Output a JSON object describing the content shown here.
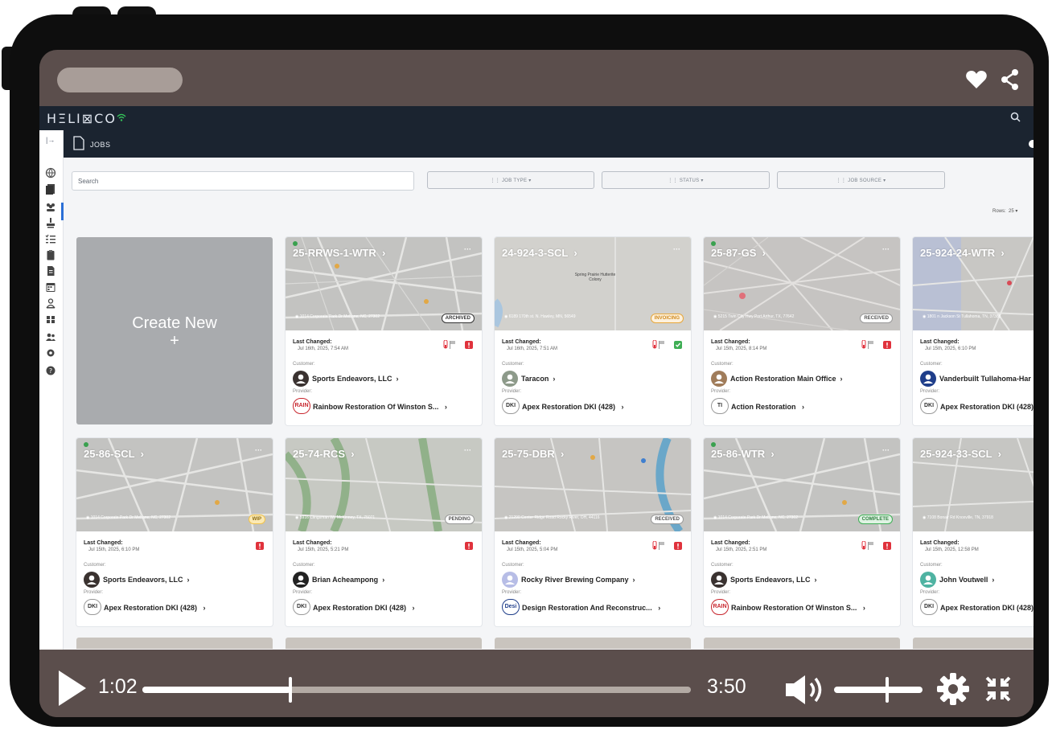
{
  "app": {
    "logo": "HΞLI⊠CO",
    "page_title": "JOBS",
    "search_placeholder": "Search",
    "filters": [
      "JOB TYPE",
      "STATUS",
      "JOB SOURCE"
    ],
    "rows_label": "Rows:",
    "rows_value": "25",
    "create_label": "Create New",
    "create_plus": "+"
  },
  "labels": {
    "last_changed": "Last Changed:",
    "customer": "Customer:",
    "provider": "Provider:",
    "more": "···"
  },
  "jobs": [
    {
      "id": "25-RRWS-1-WTR",
      "address": "1014 Corporate Park Dr Mebane, NC, 27302",
      "status": "ARCHIVED",
      "last_changed": "Jul 16th, 2025, 7:54 AM",
      "customer": "Sports Endeavors, LLC",
      "provider": "Rainbow Restoration Of Winston S...",
      "provider_badge": "RAIN"
    },
    {
      "id": "24-924-3-SCL",
      "address": "6189 170th st. N. Hawley, MN, 56549",
      "status": "INVOICING",
      "last_changed": "Jul 16th, 2025, 7:51 AM",
      "customer": "Taracon",
      "provider": "Apex Restoration DKI (428)",
      "provider_badge": "DKI",
      "map_text": "Spring Prairie Hutterite Colony"
    },
    {
      "id": "25-87-GS",
      "address": "5215 Twin City Hwy Port Arthur, TX, 77642",
      "status": "RECEIVED",
      "last_changed": "Jul 15th, 2025, 8:14 PM",
      "customer": "Action Restoration Main Office",
      "provider": "Action Restoration",
      "provider_badge": "TI"
    },
    {
      "id": "25-924-24-WTR",
      "address": "1801 n Jackson St Tullahoma, TN, 37388",
      "status": "",
      "last_changed": "Jul 15th, 2025, 6:10 PM",
      "customer": "Vanderbuilt Tullahoma-Har",
      "provider": "Apex Restoration DKI (428)",
      "provider_badge": "DKI"
    },
    {
      "id": "25-86-SCL",
      "address": "1014 Corporate Park Dr Mebane, NC, 27302",
      "status": "WIP",
      "last_changed": "Jul 15th, 2025, 6:10 PM",
      "customer": "Sports Endeavors, LLC",
      "provider": "Apex Restoration DKI (428)",
      "provider_badge": "DKI"
    },
    {
      "id": "25-74-RCS",
      "address": "5916 Clingsman Wy McKinney, TX, 75071",
      "status": "PENDING",
      "last_changed": "Jul 15th, 2025, 5:21 PM",
      "customer": "Brian Acheampong",
      "provider": "Apex Restoration DKI (428)",
      "provider_badge": "DKI"
    },
    {
      "id": "25-75-DBR",
      "address": "21290 Center Ridge Road Rocky River, OH, 44116",
      "status": "RECEIVED",
      "last_changed": "Jul 15th, 2025, 5:04 PM",
      "customer": "Rocky River Brewing Company",
      "provider": "Design Restoration And Reconstruc...",
      "provider_badge": "Desi"
    },
    {
      "id": "25-86-WTR",
      "address": "1014 Corporate Park Dr Mebane, NC, 27302",
      "status": "COMPLETE",
      "last_changed": "Jul 15th, 2025, 2:51 PM",
      "customer": "Sports Endeavors, LLC",
      "provider": "Rainbow Restoration Of Winston S...",
      "provider_badge": "RAIN"
    },
    {
      "id": "25-924-33-SCL",
      "address": "7108 Bonair Rd Knoxville, TN, 37918",
      "status": "",
      "last_changed": "Jul 15th, 2025, 12:58 PM",
      "customer": "John Voutwell",
      "provider": "Apex Restoration DKI (428)",
      "provider_badge": "DKI"
    }
  ],
  "video": {
    "current_time": "1:02",
    "total_time": "3:50",
    "progress": 0.27,
    "volume": 0.6
  },
  "icons": [
    "heart-icon",
    "share-icon",
    "play-icon",
    "volume-icon",
    "gear-icon",
    "fullscreen-exit-icon",
    "search-icon",
    "wifi-icon",
    "document-icon"
  ],
  "colors": {
    "topbar": "#1b2430",
    "accent": "#2b6fd6",
    "video_bg": "#5b4e4c",
    "archived": "#333333",
    "invoicing": "#e7a73a",
    "wip": "#f1c24a",
    "complete": "#3fae55",
    "alert": "#e0323c"
  }
}
